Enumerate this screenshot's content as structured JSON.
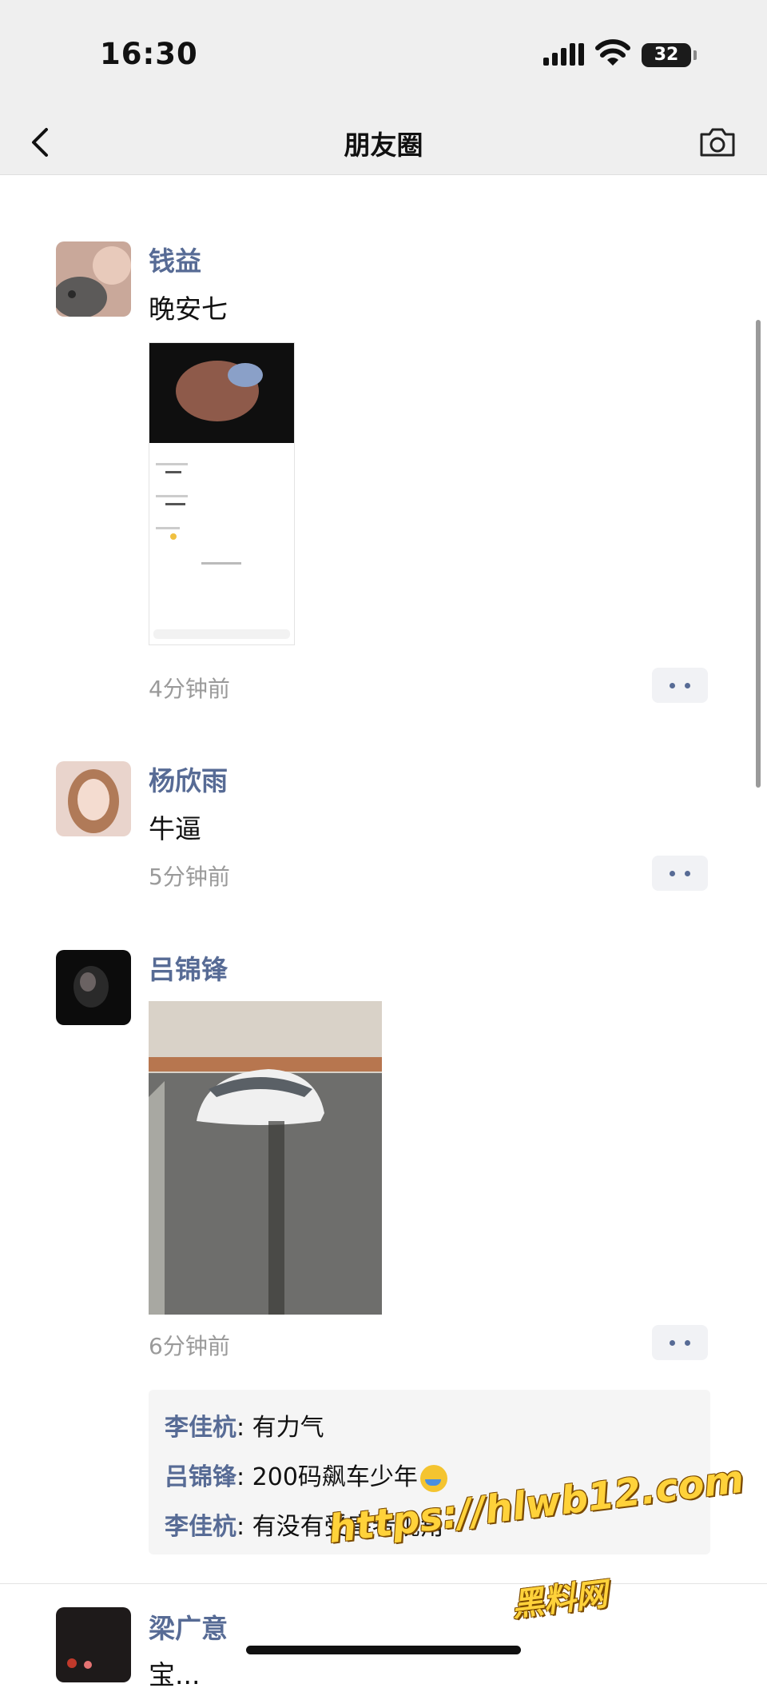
{
  "status": {
    "time": "16:30",
    "battery": "32"
  },
  "nav": {
    "title": "朋友圈"
  },
  "posts": [
    {
      "name": "钱益",
      "text": "晚安七",
      "time": "4分钟前",
      "image_icon": "screenshot-image"
    },
    {
      "name": "杨欣雨",
      "text": "牛逼",
      "time": "5分钟前"
    },
    {
      "name": "吕锦锋",
      "time": "6分钟前",
      "image_icon": "crashed-car-photo",
      "comments": [
        {
          "name": "李佳杭",
          "text": ": 有力气"
        },
        {
          "name": "吕锦锋",
          "text": ": 200码飙车少年"
        },
        {
          "name": "李佳杭",
          "text": ": 有没有受害者视角"
        }
      ]
    },
    {
      "name": "梁广意",
      "text": "宝..."
    }
  ],
  "watermark": {
    "line1": "https://hlwb12.com",
    "line2": "黑料网"
  },
  "colors": {
    "name_blue": "#576b95",
    "nav_bg": "#efefef",
    "time_gray": "#9a9a9a"
  }
}
